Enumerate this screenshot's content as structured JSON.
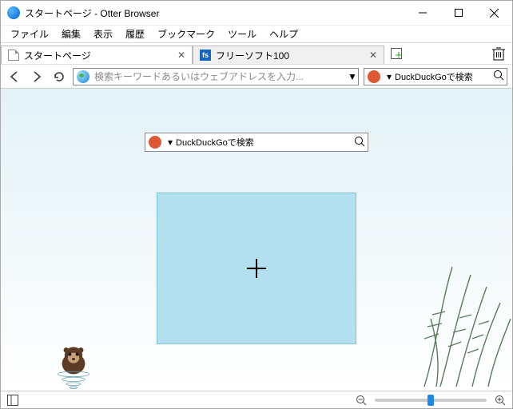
{
  "window": {
    "title": "スタートページ - Otter Browser"
  },
  "menu": {
    "file": "ファイル",
    "edit": "編集",
    "view": "表示",
    "history": "履歴",
    "bookmarks": "ブックマーク",
    "tools": "ツール",
    "help": "ヘルプ"
  },
  "tabs": [
    {
      "label": "スタートページ",
      "iconText": ""
    },
    {
      "label": "フリーソフト100",
      "iconText": "fs"
    }
  ],
  "address": {
    "placeholder": "検索キーワードあるいはウェブアドレスを入力..."
  },
  "topSearch": {
    "label": "DuckDuckGoで検索"
  },
  "centerSearch": {
    "label": "DuckDuckGoで検索"
  }
}
